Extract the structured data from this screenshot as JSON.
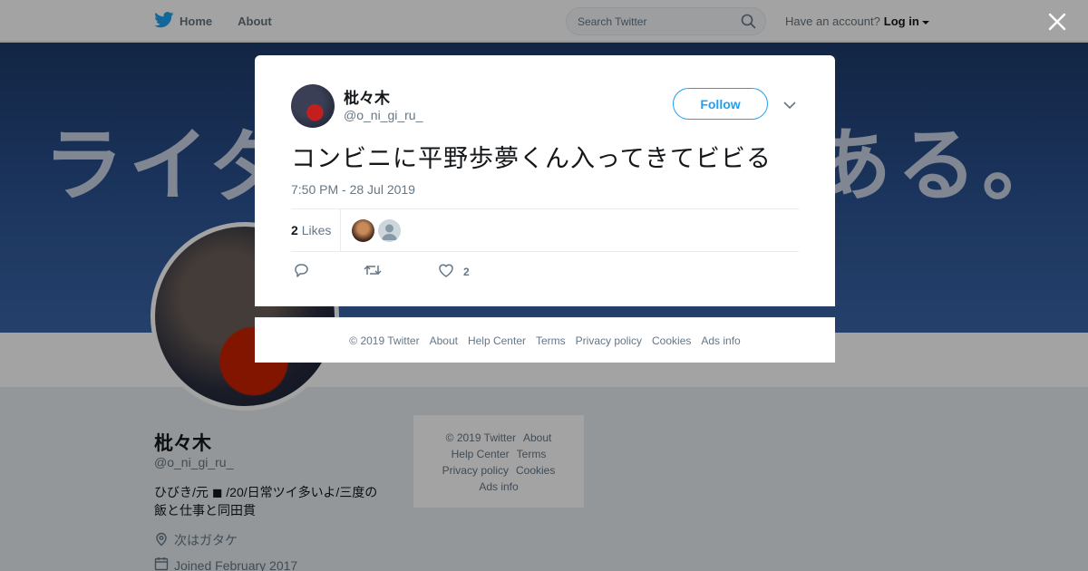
{
  "nav": {
    "home_label": "Home",
    "about_label": "About",
    "search_placeholder": "Search Twitter",
    "account_prompt": "Have an account?",
    "login_label": "Log in",
    "brand_color": "#1da1f2"
  },
  "banner": {
    "text_left": "ライダ",
    "text_right": "である。"
  },
  "profile": {
    "name": "枇々木",
    "handle": "@o_ni_gi_ru_",
    "bio": "ひびき/元 ◼ /20/日常ツイ多いよ/三度の飯と仕事と同田貫",
    "location": "次はガタケ",
    "joined": "Joined February 2017"
  },
  "side_footer": {
    "copyright": "© 2019 Twitter",
    "about": "About",
    "help": "Help Center",
    "terms": "Terms",
    "privacy": "Privacy policy",
    "cookies": "Cookies",
    "ads": "Ads info"
  },
  "tweet": {
    "name": "枇々木",
    "handle": "@o_ni_gi_ru_",
    "follow_label": "Follow",
    "text": "コンビニに平野歩夢くん入ってきてビビる",
    "timestamp": "7:50 PM - 28 Jul 2019",
    "likes_count": "2",
    "likes_label": "Likes",
    "like_action_count": "2"
  },
  "modal_footer": {
    "copyright": "© 2019 Twitter",
    "about": "About",
    "help": "Help Center",
    "terms": "Terms",
    "privacy": "Privacy policy",
    "cookies": "Cookies",
    "ads": "Ads info"
  },
  "icons": {
    "twitter": "twitter-bird-icon",
    "search": "search-icon",
    "close": "close-icon",
    "reply": "reply-icon",
    "retweet": "retweet-icon",
    "like": "heart-icon",
    "location": "location-pin-icon",
    "calendar": "calendar-icon"
  }
}
